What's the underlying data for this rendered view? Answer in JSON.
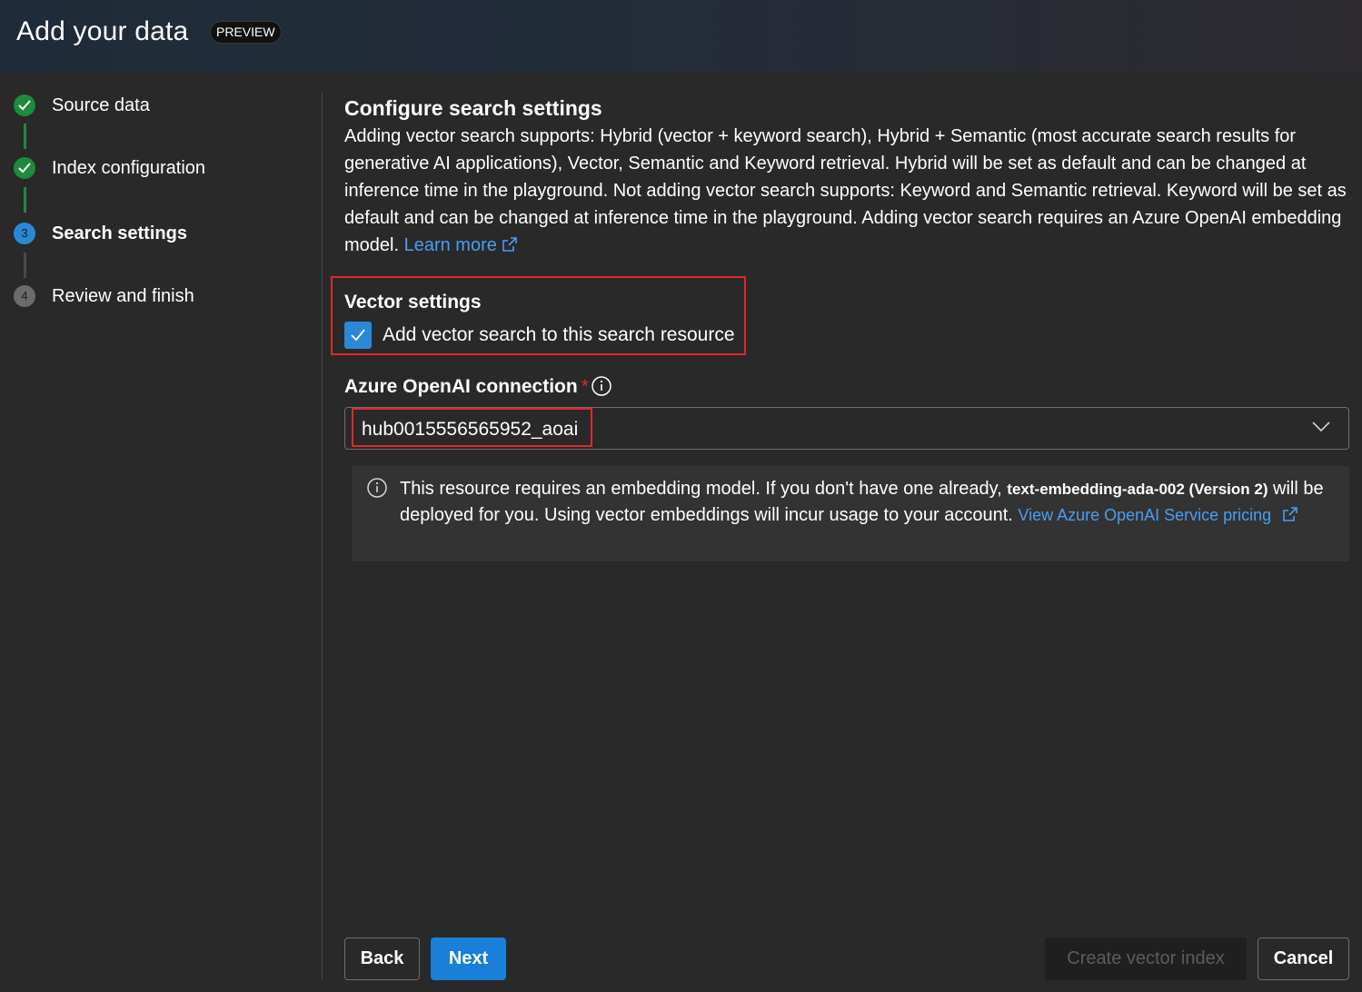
{
  "header": {
    "title": "Add your data",
    "badge": "PREVIEW"
  },
  "steps": [
    {
      "number": "",
      "label": "Source data",
      "state": "done"
    },
    {
      "number": "",
      "label": "Index configuration",
      "state": "done"
    },
    {
      "number": "3",
      "label": "Search settings",
      "state": "current"
    },
    {
      "number": "4",
      "label": "Review and finish",
      "state": "pending"
    }
  ],
  "main": {
    "title": "Configure search settings",
    "description": "Adding vector search supports: Hybrid (vector + keyword search), Hybrid + Semantic (most accurate search results for generative AI applications), Vector, Semantic and Keyword retrieval. Hybrid will be set as default and can be changed at inference time in the playground. Not adding vector search supports: Keyword and Semantic retrieval. Keyword will be set as default and can be changed at inference time in the playground. Adding vector search requires an Azure OpenAI embedding model.",
    "learn_more": "Learn more",
    "vector_settings_title": "Vector settings",
    "vector_checkbox_label": "Add vector search to this search resource",
    "vector_checkbox_checked": true,
    "connection_label": "Azure OpenAI connection",
    "required_mark": "*",
    "connection_value": "hub0015556565952_aoai",
    "notice": {
      "text_before": "This resource requires an embedding model. If you don't have one already,",
      "model": "text-embedding-ada-002 (Version 2)",
      "text_after": "will be deployed for you. Using vector embeddings will incur usage to your account.",
      "link": "View Azure OpenAI Service pricing"
    }
  },
  "footer": {
    "back": "Back",
    "next": "Next",
    "create": "Create vector index",
    "cancel": "Cancel"
  },
  "colors": {
    "background": "#292929",
    "accent": "#2b88d8",
    "success": "#1f8a3b",
    "highlight": "#e0282c",
    "link": "#479ef5"
  },
  "icons": [
    "checkmark-icon",
    "info-icon",
    "chevron-down-icon",
    "open-external-icon"
  ]
}
